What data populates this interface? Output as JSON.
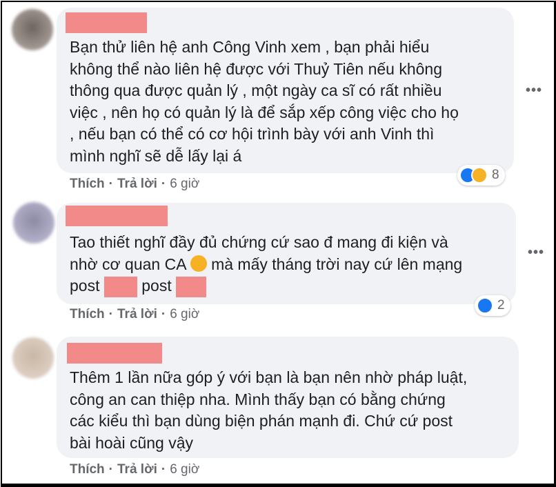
{
  "comments": [
    {
      "text_lines": [
        "Bạn thử liên hệ anh Công Vinh xem , bạn phải hiểu",
        "không thể nào liên hệ được với Thuỷ Tiên nếu không",
        "thông qua được quản lý , một ngày ca sĩ có rất nhiều",
        "việc , nên họ có quản lý là để sắp xếp công việc cho họ",
        ", nếu bạn có thể có cơ hội trình bày với anh Vinh thì",
        "mình nghĩ sẽ dễ lấy lại á"
      ],
      "reaction_count": "8",
      "actions": {
        "like": "Thích",
        "reply": "Trả lời",
        "time": "6 giờ"
      }
    },
    {
      "line1": "Tao thiết nghĩ đầy đủ chứng cứ sao đ mang đi kiện và",
      "line2_a": "nhờ cơ quan CA",
      "line2_b": "mà mấy tháng trời nay cứ lên mạng",
      "line3_a": "post",
      "line3_b": "post",
      "reaction_count": "2",
      "actions": {
        "like": "Thích",
        "reply": "Trả lời",
        "time": "6 giờ"
      }
    },
    {
      "text_lines": [
        "Thêm 1 lần nữa góp ý với bạn là bạn nên nhờ pháp luật,",
        "công an can thiệp nha. Mình thấy bạn có bằng chứng",
        "các kiểu thì bạn dùng biện phán mạnh đi. Chứ cứ post",
        "bài hoài cũng vậy"
      ],
      "actions": {
        "like": "Thích",
        "reply": "Trả lời",
        "time": "6 giờ"
      }
    }
  ],
  "icons": [
    "more-options-icon",
    "like-reaction-icon",
    "haha-reaction-icon",
    "laughing-emoji-icon"
  ],
  "colors": {
    "bubble": "#f0f2f5",
    "redaction": "#f28a8a",
    "like": "#1877f2",
    "haha": "#f7b125",
    "meta_text": "#65676b"
  },
  "more_label": "•••"
}
